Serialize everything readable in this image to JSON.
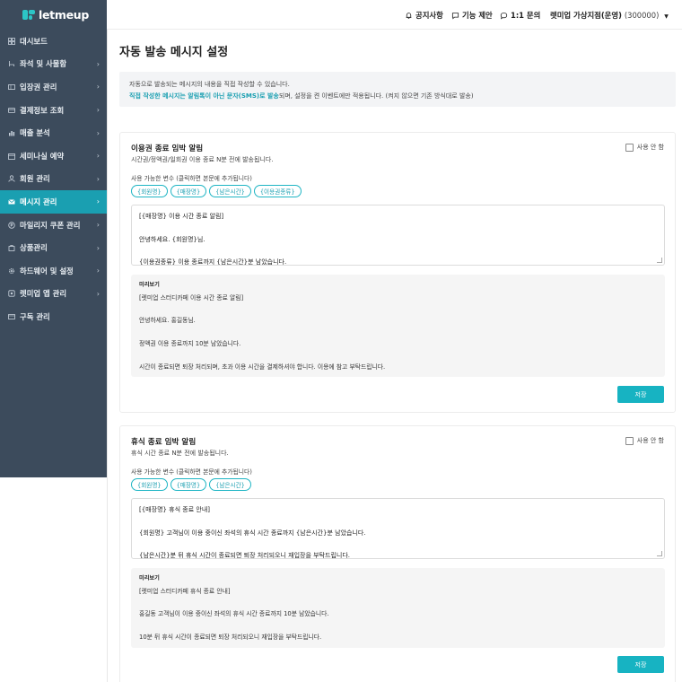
{
  "app": {
    "logo_text": "letmeup"
  },
  "header": {
    "links": [
      {
        "label": "공지사항",
        "icon": "bell-icon"
      },
      {
        "label": "기능 제안",
        "icon": "message-square-icon"
      },
      {
        "label": "1:1 문의",
        "icon": "chat-bubble-icon"
      }
    ],
    "store_name": "렛미업 가상지점(운영)",
    "store_code": "(300000)"
  },
  "sidebar": {
    "items": [
      {
        "label": "대시보드",
        "icon": "grid-icon",
        "chevron": ""
      },
      {
        "label": "좌석 및 사물함",
        "icon": "seat-icon",
        "chevron": "›"
      },
      {
        "label": "입장권 관리",
        "icon": "ticket-icon",
        "chevron": "›"
      },
      {
        "label": "결제정보 조회",
        "icon": "card-icon",
        "chevron": "›"
      },
      {
        "label": "매출 분석",
        "icon": "chart-icon",
        "chevron": "›"
      },
      {
        "label": "세미나실 예약",
        "icon": "calendar-icon",
        "chevron": "›"
      },
      {
        "label": "회원 관리",
        "icon": "users-icon",
        "chevron": "›"
      },
      {
        "label": "메시지 관리",
        "icon": "mail-icon",
        "chevron": "›",
        "active": true
      },
      {
        "label": "마일리지 쿠폰 관리",
        "icon": "coin-icon",
        "chevron": "›"
      },
      {
        "label": "상품관리",
        "icon": "bag-icon",
        "chevron": "›"
      },
      {
        "label": "하드웨어 및 설정",
        "icon": "gear-icon",
        "chevron": "›"
      },
      {
        "label": "렛미업 앱 관리",
        "icon": "app-icon",
        "chevron": "›"
      },
      {
        "label": "구독 관리",
        "icon": "subscription-icon",
        "chevron": ""
      }
    ]
  },
  "main": {
    "title": "자동 발송 메시지 설정",
    "notice_line1": "자동으로 발송되는 메시지의 내용을 직접 작성할 수 있습니다.",
    "notice_line2_highlight": "직접 작성한 메시지는 알림톡이 아닌 문자(SMS)로 발송",
    "notice_line2_rest": "되며, 설정을 켠 이벤트에만 적용됩니다. (켜지 않으면 기존 방식대로 발송)"
  },
  "cards": [
    {
      "title": "이용권 종료 임박 알림",
      "desc": "시간권/정액권/일회권 이용 종료 N분 전에 발송됩니다.",
      "toggle_label": "사용 안 함",
      "vars_label": "사용 가능한 변수 (클릭하면 본문에 추가됩니다)",
      "chips": [
        "{회원명}",
        "{매장명}",
        "{남은시간}",
        "{이용권종류}"
      ],
      "editor_lines": [
        "[{매장명} 이용 시간 종료 알림]",
        "",
        "안녕하세요. {회원명}님.",
        "",
        "{이용권종류} 이용 종료까지 {남은시간}분 남았습니다."
      ],
      "preview_label": "미리보기",
      "preview_lines": [
        "[렛미업 스터디카페 이용 시간 종료 알림]",
        "",
        "안녕하세요. 홍길동님.",
        "",
        "정액권 이용 종료까지 10분 남았습니다.",
        "",
        "시간이 종료되면 퇴장 처리되며, 초과 이용 시간을 결제하셔야 합니다. 이용에 참고 부탁드립니다."
      ],
      "save_label": "저장"
    },
    {
      "title": "휴식 종료 임박 알림",
      "desc": "휴식 시간 종료 N분 전에 발송됩니다.",
      "toggle_label": "사용 안 함",
      "vars_label": "사용 가능한 변수 (클릭하면 본문에 추가됩니다)",
      "chips": [
        "{회원명}",
        "{매장명}",
        "{남은시간}"
      ],
      "editor_lines": [
        "[{매장명} 휴식 종료 안내]",
        "",
        "{회원명} 고객님이 이용 중이신 좌석의 휴식 시간 종료까지 {남은시간}분 남았습니다.",
        "",
        "{남은시간}분 뒤 휴식 시간이 종료되면 퇴장 처리되오니 재입장을 부탁드립니다."
      ],
      "preview_label": "미리보기",
      "preview_lines": [
        "[렛미업 스터디카페 휴식 종료 안내]",
        "",
        "홍길동 고객님이 이용 중이신 좌석의 휴식 시간 종료까지 10분 남았습니다.",
        "",
        "10분 뒤 휴식 시간이 종료되면 퇴장 처리되오니 재입장을 부탁드립니다."
      ],
      "save_label": "저장"
    }
  ]
}
